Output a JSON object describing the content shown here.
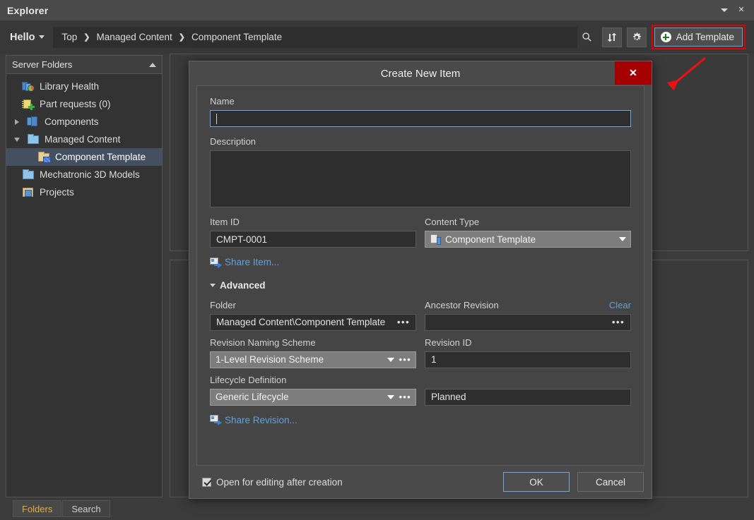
{
  "window": {
    "title": "Explorer",
    "controls": [
      {
        "name": "minimize-dropdown-button",
        "glyph": "▾"
      },
      {
        "name": "close-window-button",
        "glyph": "✕"
      }
    ]
  },
  "toolbar": {
    "account_label": "Hello",
    "breadcrumb": [
      "Top",
      "Managed Content",
      "Component Template"
    ],
    "breadcrumb_separator": "❯",
    "search_icon": "search-icon",
    "refresh_icon": "sync-refresh-icon",
    "settings_icon": "gear-icon",
    "add_template_label": "Add Template",
    "highlight_color": "#e60000"
  },
  "sidebar": {
    "header": "Server Folders",
    "items": [
      {
        "label": "Library Health",
        "icon": "library-health-icon",
        "indent": 1,
        "twisty": "none",
        "selected": false
      },
      {
        "label": "Part requests (0)",
        "icon": "part-requests-icon",
        "indent": 1,
        "twisty": "none",
        "selected": false
      },
      {
        "label": "Components",
        "icon": "components-icon",
        "indent": 0,
        "twisty": "closed",
        "selected": false
      },
      {
        "label": "Managed Content",
        "icon": "folder-icon",
        "indent": 0,
        "twisty": "open",
        "selected": false
      },
      {
        "label": "Component Template",
        "icon": "component-template-icon",
        "indent": 2,
        "twisty": "none",
        "selected": true
      },
      {
        "label": "Mechatronic 3D Models",
        "icon": "folder-icon",
        "indent": 1,
        "twisty": "none",
        "selected": false
      },
      {
        "label": "Projects",
        "icon": "projects-icon",
        "indent": 1,
        "twisty": "none",
        "selected": false
      }
    ],
    "tabs": [
      {
        "label": "Folders",
        "active": true
      },
      {
        "label": "Search",
        "active": false
      }
    ]
  },
  "dialog": {
    "title": "Create New Item",
    "close_glyph": "✕",
    "name_label": "Name",
    "name_value": "",
    "description_label": "Description",
    "description_value": "",
    "item_id_label": "Item ID",
    "item_id_value": "CMPT-0001",
    "content_type_label": "Content Type",
    "content_type_value": "Component Template",
    "share_item_link": "Share Item...",
    "advanced_label": "Advanced",
    "folder_label": "Folder",
    "folder_value": "Managed Content\\Component Template",
    "ancestor_revision_label": "Ancestor Revision",
    "ancestor_revision_value": "",
    "ancestor_clear_label": "Clear",
    "revision_naming_label": "Revision Naming Scheme",
    "revision_naming_value": "1-Level Revision Scheme",
    "revision_id_label": "Revision ID",
    "revision_id_value": "1",
    "lifecycle_label": "Lifecycle Definition",
    "lifecycle_value": "Generic Lifecycle",
    "lifecycle_state_value": "Planned",
    "share_revision_link": "Share Revision...",
    "open_for_editing_label": "Open for editing after creation",
    "open_for_editing_checked": true,
    "ok_label": "OK",
    "cancel_label": "Cancel",
    "ellipsis": "•••",
    "close_button_color": "#a50000"
  },
  "annotation": {
    "arrow_color": "#ee1111",
    "points_to": "Add Template"
  }
}
